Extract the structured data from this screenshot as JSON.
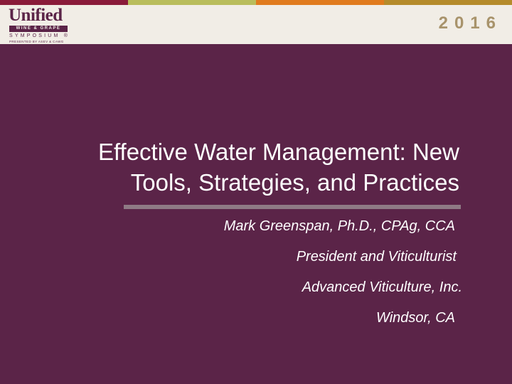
{
  "header": {
    "logo": {
      "name": "Unified",
      "band": "WINE & GRAPE",
      "symposium": "SYMPOSIUM",
      "registered": "®",
      "presented_by": "PRESENTED BY ASEV & CAWG"
    },
    "year": "2016",
    "stripe_colors": [
      "#8a1b3a",
      "#b9bd5c",
      "#e07b1e",
      "#b58b2b"
    ]
  },
  "slide": {
    "title_lines": [
      "Effective Water Management: New",
      "Tools, Strategies, and Practices"
    ],
    "subtitle_lines": [
      "Mark Greenspan, Ph.D., CPAg, CCA",
      "President and Viticulturist",
      "Advanced Viticulture, Inc.",
      "Windsor, CA"
    ]
  },
  "colors": {
    "background": "#5b2448",
    "header_background": "#f1ede6",
    "year_color": "#a8936b",
    "text": "#ffffff"
  }
}
